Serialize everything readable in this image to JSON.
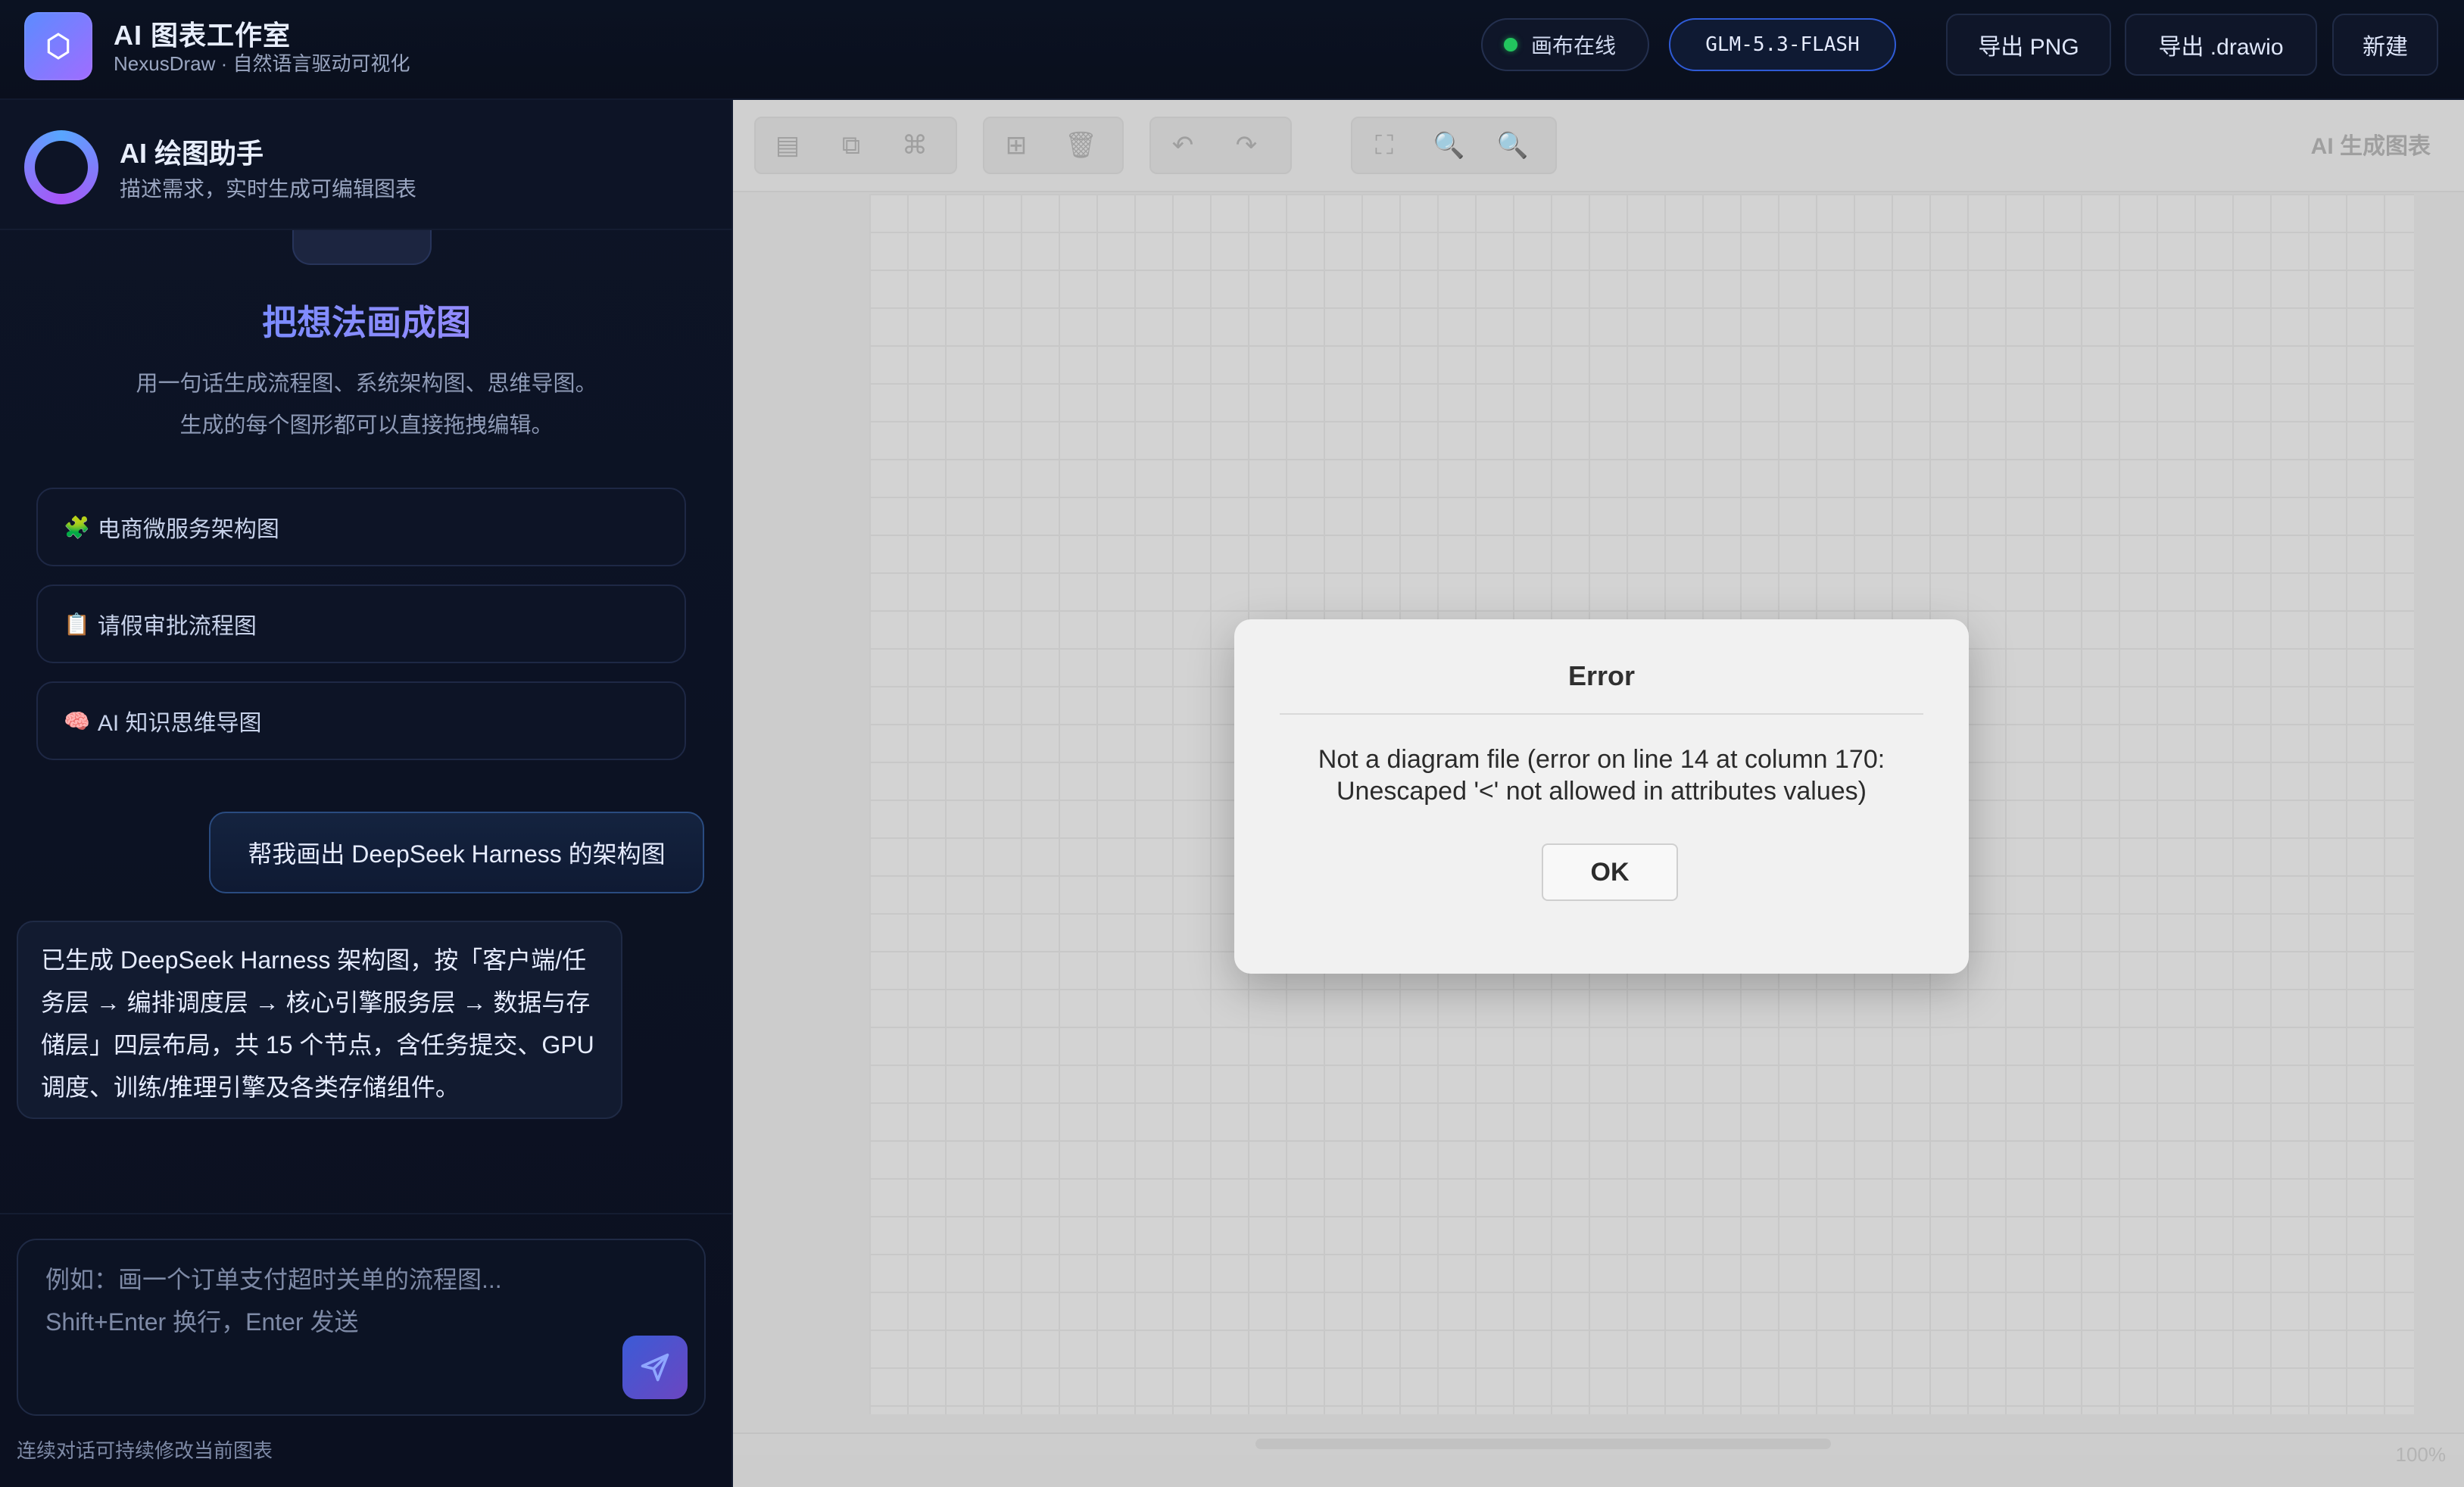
{
  "header": {
    "title": "AI 图表工作室",
    "subtitle": "NexusDraw · 自然语言驱动可视化",
    "status_label": "画布在线",
    "model_label": "GLM-5.3-FLASH",
    "export_png": "导出 PNG",
    "export_drawio": "导出 .drawio",
    "new_label": "新建"
  },
  "assistant": {
    "title": "AI 绘图助手",
    "subtitle": "描述需求，实时生成可编辑图表"
  },
  "hero": {
    "title": "把想法画成图",
    "desc_line1": "用一句话生成流程图、系统架构图、思维导图。",
    "desc_line2": "生成的每个图形都可以直接拖拽编辑。"
  },
  "examples": [
    {
      "emoji": "🧩",
      "label": "电商微服务架构图"
    },
    {
      "emoji": "📋",
      "label": "请假审批流程图"
    },
    {
      "emoji": "🧠",
      "label": "AI 知识思维导图"
    }
  ],
  "chat": {
    "user": "帮我画出 DeepSeek Harness 的架构图",
    "bot": "已生成 DeepSeek Harness 架构图，按「客户端/任务层 → 编排调度层 → 核心引擎服务层 → 数据与存储层」四层布局，共 15 个节点，含任务提交、GPU 调度、训练/推理引擎及各类存储组件。"
  },
  "composer": {
    "placeholder": "例如：画一个订单支付超时关单的流程图...\nShift+Enter 换行，Enter 发送",
    "hint": "连续对话可持续修改当前图表"
  },
  "canvas": {
    "ai_label": "AI 生成图表",
    "zoom": "100%"
  },
  "dialog": {
    "title": "Error",
    "message": "Not a diagram file (error on line 14 at column 170: Unescaped '<' not allowed in attributes values)",
    "ok": "OK"
  },
  "colors": {
    "accent1": "#4f7cff",
    "accent2": "#a855f7",
    "status_green": "#22c55e",
    "panel": "#0f1629"
  }
}
